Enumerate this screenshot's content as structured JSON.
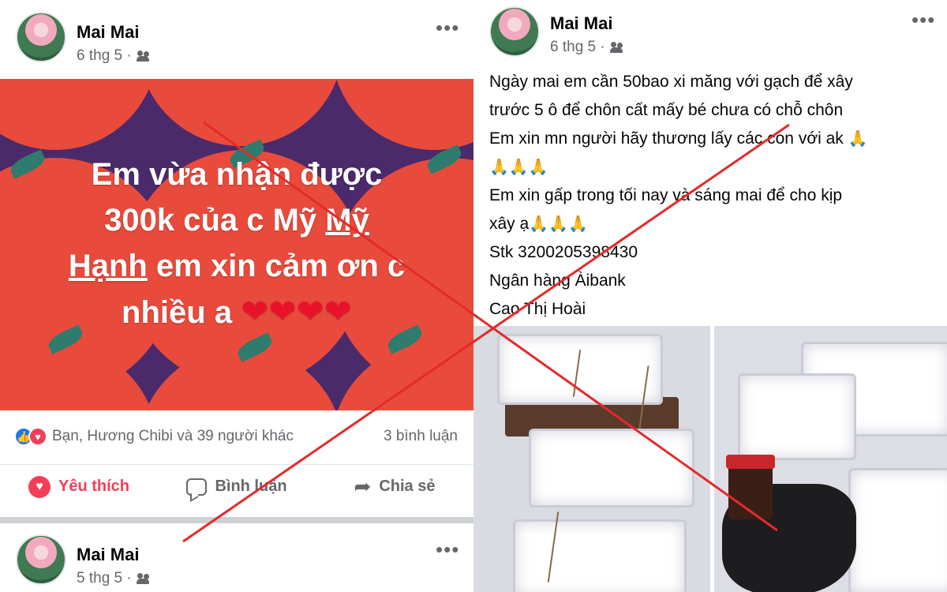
{
  "left_post": {
    "author": "Mai Mai",
    "time": "6 thg 5 ·",
    "banner": {
      "line1": "Em vừa nhận được",
      "line2_pre": "300k của c Mỹ ",
      "line2_ul": "Mỹ",
      "line3_ul": "Hạnh",
      "line3_post": " em xin cảm ơn c",
      "line4": "nhiều a ",
      "hearts": "❤❤❤❤"
    },
    "reactions_text": "Bạn, Hương Chibi và 39 người khác",
    "comment_count": "3 bình luận",
    "actions": {
      "like": "Yêu thích",
      "comment": "Bình luận",
      "share": "Chia sẻ"
    },
    "icons": {
      "like": "thumbs-up-icon",
      "love": "heart-icon",
      "comment": "comment-icon",
      "share": "share-arrow-icon"
    }
  },
  "second_post": {
    "author": "Mai Mai",
    "time": "5 thg 5 ·"
  },
  "right_post": {
    "author": "Mai Mai",
    "time": "6 thg 5 ·",
    "text": {
      "l1": "Ngày mai em cần 50bao xi măng với gạch để xây",
      "l2": "trước 5 ô để chôn cất mấy bé chưa có chỗ chôn",
      "l3": "Em xin mn người hãy thương lấy các con với ak",
      "l3_emoji": "🙏",
      "l4_emoji": "🙏🙏🙏",
      "l5": "Em xin gấp trong tối nay và sáng mai để cho kịp",
      "l6": "xây ạ",
      "l6_emoji": "🙏🙏🙏",
      "l7": "Stk 3200205398430",
      "l8": "Ngân hàng Àibank",
      "l9": "Cao Thị Hoài"
    }
  },
  "colors": {
    "cross_mark": "#e52a2a",
    "banner_red": "#dd3f35",
    "banner_purple": "#4b2a6b",
    "love_red": "#f33e58",
    "like_blue": "#1877f2"
  }
}
